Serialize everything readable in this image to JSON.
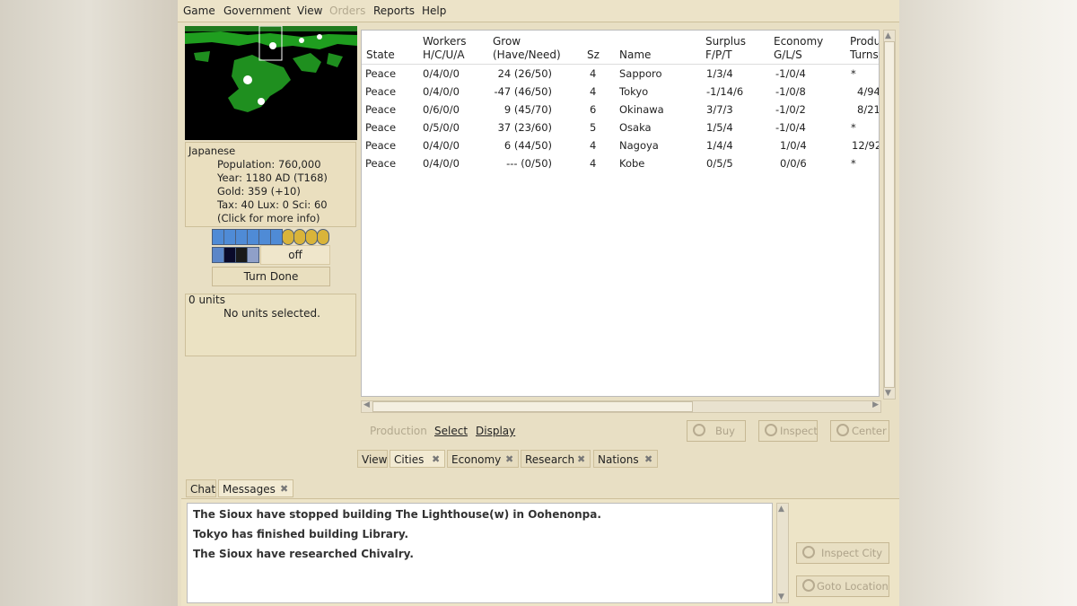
{
  "menu": [
    "Game",
    "Government",
    "View",
    "Orders",
    "Reports",
    "Help"
  ],
  "overview": {
    "nation": "Japanese",
    "population": "Population: 760,000",
    "year": "Year: 1180 AD (T168)",
    "gold": "Gold: 359 (+10)",
    "tax": "Tax: 40 Lux: 0 Sci: 60",
    "more": "(Click for more info)"
  },
  "status": {
    "off_label": "off",
    "turn_done": "Turn Done"
  },
  "units": {
    "count": "0 units",
    "selected": "No units selected."
  },
  "table": {
    "headers": [
      {
        "l1": "",
        "l2": "State"
      },
      {
        "l1": "Workers",
        "l2": "H/C/U/A"
      },
      {
        "l1": "Grow",
        "l2": "(Have/Need)"
      },
      {
        "l1": "",
        "l2": "Sz"
      },
      {
        "l1": "",
        "l2": "Name"
      },
      {
        "l1": "Surplus",
        "l2": "F/P/T"
      },
      {
        "l1": "Economy",
        "l2": "G/L/S"
      },
      {
        "l1": "Produ",
        "l2": "Turns/"
      }
    ],
    "rows": [
      [
        "Peace",
        "0/4/0/0",
        "24 (26/50)",
        "4",
        "Sapporo",
        "1/3/4",
        "-1/0/4",
        "*"
      ],
      [
        "Peace",
        "0/4/0/0",
        "-47 (46/50)",
        "4",
        "Tokyo",
        "-1/14/6",
        "-1/0/8",
        "4/94"
      ],
      [
        "Peace",
        "0/6/0/0",
        "9 (45/70)",
        "6",
        "Okinawa",
        "3/7/3",
        "-1/0/2",
        "8/21"
      ],
      [
        "Peace",
        "0/5/0/0",
        "37 (23/60)",
        "5",
        "Osaka",
        "1/5/4",
        "-1/0/4",
        "*"
      ],
      [
        "Peace",
        "0/4/0/0",
        "6 (44/50)",
        "4",
        "Nagoya",
        "1/4/4",
        "1/0/4",
        "12/92"
      ],
      [
        "Peace",
        "0/4/0/0",
        "--- (0/50)",
        "4",
        "Kobe",
        "0/5/5",
        "0/0/6",
        "*"
      ]
    ]
  },
  "city_actions": {
    "production": "Production",
    "select": "Select",
    "display": "Display",
    "buy": "Buy",
    "inspect": "Inspect",
    "center": "Center"
  },
  "tabs": [
    "View",
    "Cities",
    "Economy",
    "Research",
    "Nations"
  ],
  "bottom_tabs": [
    "Chat",
    "Messages"
  ],
  "messages": [
    "The Sioux have stopped building The Lighthouse(w) in Oohenonpa.",
    "Tokyo has finished building Library.",
    "The Sioux have researched Chivalry."
  ],
  "message_actions": {
    "inspect_city": "Inspect City",
    "goto_location": "Goto Location"
  }
}
